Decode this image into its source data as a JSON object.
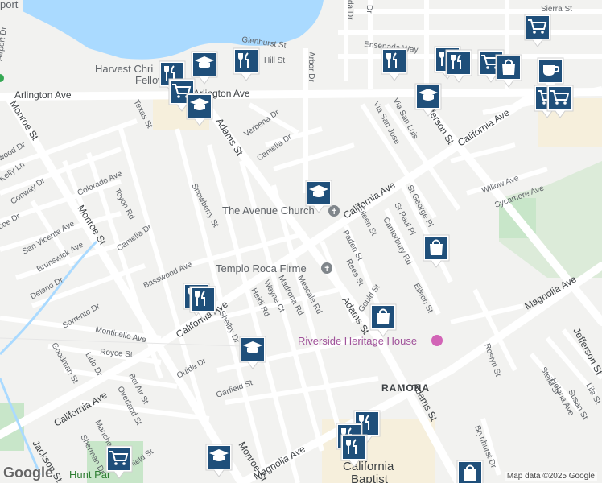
{
  "map": {
    "attribution": "Map data ©2025 Google",
    "logo": "Google",
    "colors": {
      "background": "#f2f2f0",
      "road": "#ffffff",
      "road_border": "#d8d8d8",
      "water": "#aadaff",
      "park": "#c8e6c9",
      "campus": "#f6efdc",
      "marker_bg": "#1f4f7a",
      "church_icon": "#80868b",
      "heritage_icon": "#d264b6"
    },
    "streets": {
      "arlington_ave": "Arlington Ave",
      "adams_st_north": "Adams St",
      "adams_st_mid": "Adams St",
      "adams_st_south": "Adams St",
      "california_ave_east": "California Ave",
      "california_ave_mid": "California Ave",
      "california_ave_west": "California Ave",
      "california_ave_sw": "California Ave",
      "magnolia_ave_east": "Magnolia Ave",
      "magnolia_ave_west": "Magnolia Ave",
      "monroe_st_north": "Monroe St",
      "monroe_st_mid": "Monroe St",
      "monroe_st_south": "Monroe St",
      "jefferson_st_north": "Jefferson St",
      "jefferson_st_south": "Jefferson St",
      "jackson_st": "Jackson St",
      "camelia_dr_north": "Camelia Dr",
      "camelia_dr_west": "Camelia Dr",
      "verbena_dr": "Verbena Dr",
      "texas_st": "Texas St",
      "colorado_ave": "Colorado Ave",
      "toyon_rd": "Toyon Rd",
      "snowberry_st": "Snowberry St",
      "basswood_ave": "Basswood Ave",
      "san_vicente_ave": "San Vicente Ave",
      "brunswick_ave": "Brunswick Ave",
      "delano_dr": "Delano Dr",
      "conway_dr": "Conway Dr",
      "kelly_ln": "Kelly Ln",
      "wood_dr": "wood Dr",
      "coe_dr": "coe Dr",
      "sorrento_dr": "Sorrento Dr",
      "monticello_ave": "Monticello Ave",
      "royce_st": "Royce St",
      "goodman_st": "Goodman St",
      "lido_dr": "Lido Dr",
      "bel_air_st": "Bel Air St",
      "overland_st": "Overland St",
      "manchester_pl": "Manchester Pl",
      "sherman_dr": "Sherman Dr",
      "field_st": "field St",
      "ouida_dr": "Ouida Dr",
      "garfield_st": "Garfield St",
      "shelby_dr": "Shelby Dr",
      "heidi_rd": "Heidi Rd",
      "wayne_ct": "Wayne Ct",
      "madrona_rd": "Madrona Rd",
      "mescale_rd": "Mescale Rd",
      "rees_st": "Rees St",
      "paden_st": "Paden St",
      "eileen_st_north": "Eileen St",
      "eileen_st_south": "Eileen St",
      "gould_st": "Gould St",
      "canterbury_rd": "Canterbury Rd",
      "st_paul_pl": "St Paul Pl",
      "st_george_pl": "St George Pl",
      "via_san_jose": "Via San Jose",
      "via_san_luis": "Via San Luis",
      "arbor_dr": "Arbor Dr",
      "glenhurst_st": "Glenhurst St",
      "hill_st": "Hill St",
      "ensenada_way": "Ensenada Way",
      "sierra_st": "Sierra St",
      "airport_dr": "Airport Dr",
      "willow_ave": "Willow Ave",
      "sycamore_ave": "Sycamore Ave",
      "roslyn_st": "Roslyn St",
      "brynhurst_dr": "Brynhurst Dr",
      "stella_st": "Stella St",
      "helena_ave": "Helena Ave",
      "susan_st": "Susan St",
      "lila_st": "Lila St",
      "dr_top_1": "da Dr",
      "dr_top_2": "Dr",
      "port_top": "port"
    },
    "places": {
      "avenue_church": "The Avenue Church",
      "templo": "Templo Roca Firme",
      "riverside_heritage": "Riverside Heritage House",
      "harvest_1": "Harvest Chri",
      "harvest_2": "Fellow",
      "ramona": "RAMONA",
      "california_baptist_1": "California",
      "california_baptist_2": "Baptist",
      "hunt_park": "Hunt Par"
    },
    "markers": [
      {
        "name": "restaurant-marker",
        "icon": "restaurant-icon"
      },
      {
        "name": "school-marker",
        "icon": "school-icon"
      },
      {
        "name": "grocery-marker",
        "icon": "grocery-cart-icon"
      },
      {
        "name": "shopping-marker",
        "icon": "shopping-bag-icon"
      },
      {
        "name": "cafe-marker",
        "icon": "cafe-icon"
      }
    ]
  }
}
